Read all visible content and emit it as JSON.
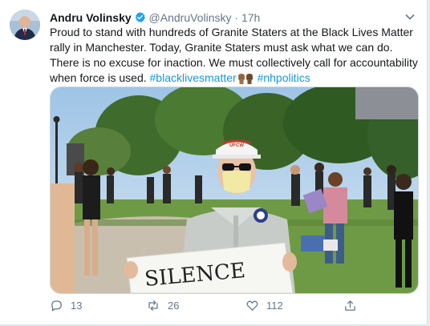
{
  "tweet": {
    "author_name": "Andru Volinsky",
    "handle": "@AndruVolinsky",
    "separator": "·",
    "time": "17h",
    "text_main": "Proud to stand with hundreds of Granite Staters at the Black Lives Matter rally in Manchester. Today, Granite Staters must ask what we can do. There is no excuse for inaction. We must collectively call for accountability when force is used.",
    "hashtag_1": "#blacklivesmatter",
    "hashtag_2": "#nhpolitics",
    "photo_sign_text": "SILENCE",
    "photo_cap_text": "UFCW",
    "replies": "13",
    "retweets": "26",
    "likes": "112"
  },
  "colors": {
    "link": "#1b95e0",
    "secondary_text": "#657786",
    "primary_text": "#14171a",
    "verified": "#1da1f2"
  },
  "icons": [
    "verified-badge-icon",
    "chevron-down-icon",
    "raised-fists-emoji-icon",
    "reply-icon",
    "retweet-icon",
    "like-icon",
    "share-icon"
  ]
}
